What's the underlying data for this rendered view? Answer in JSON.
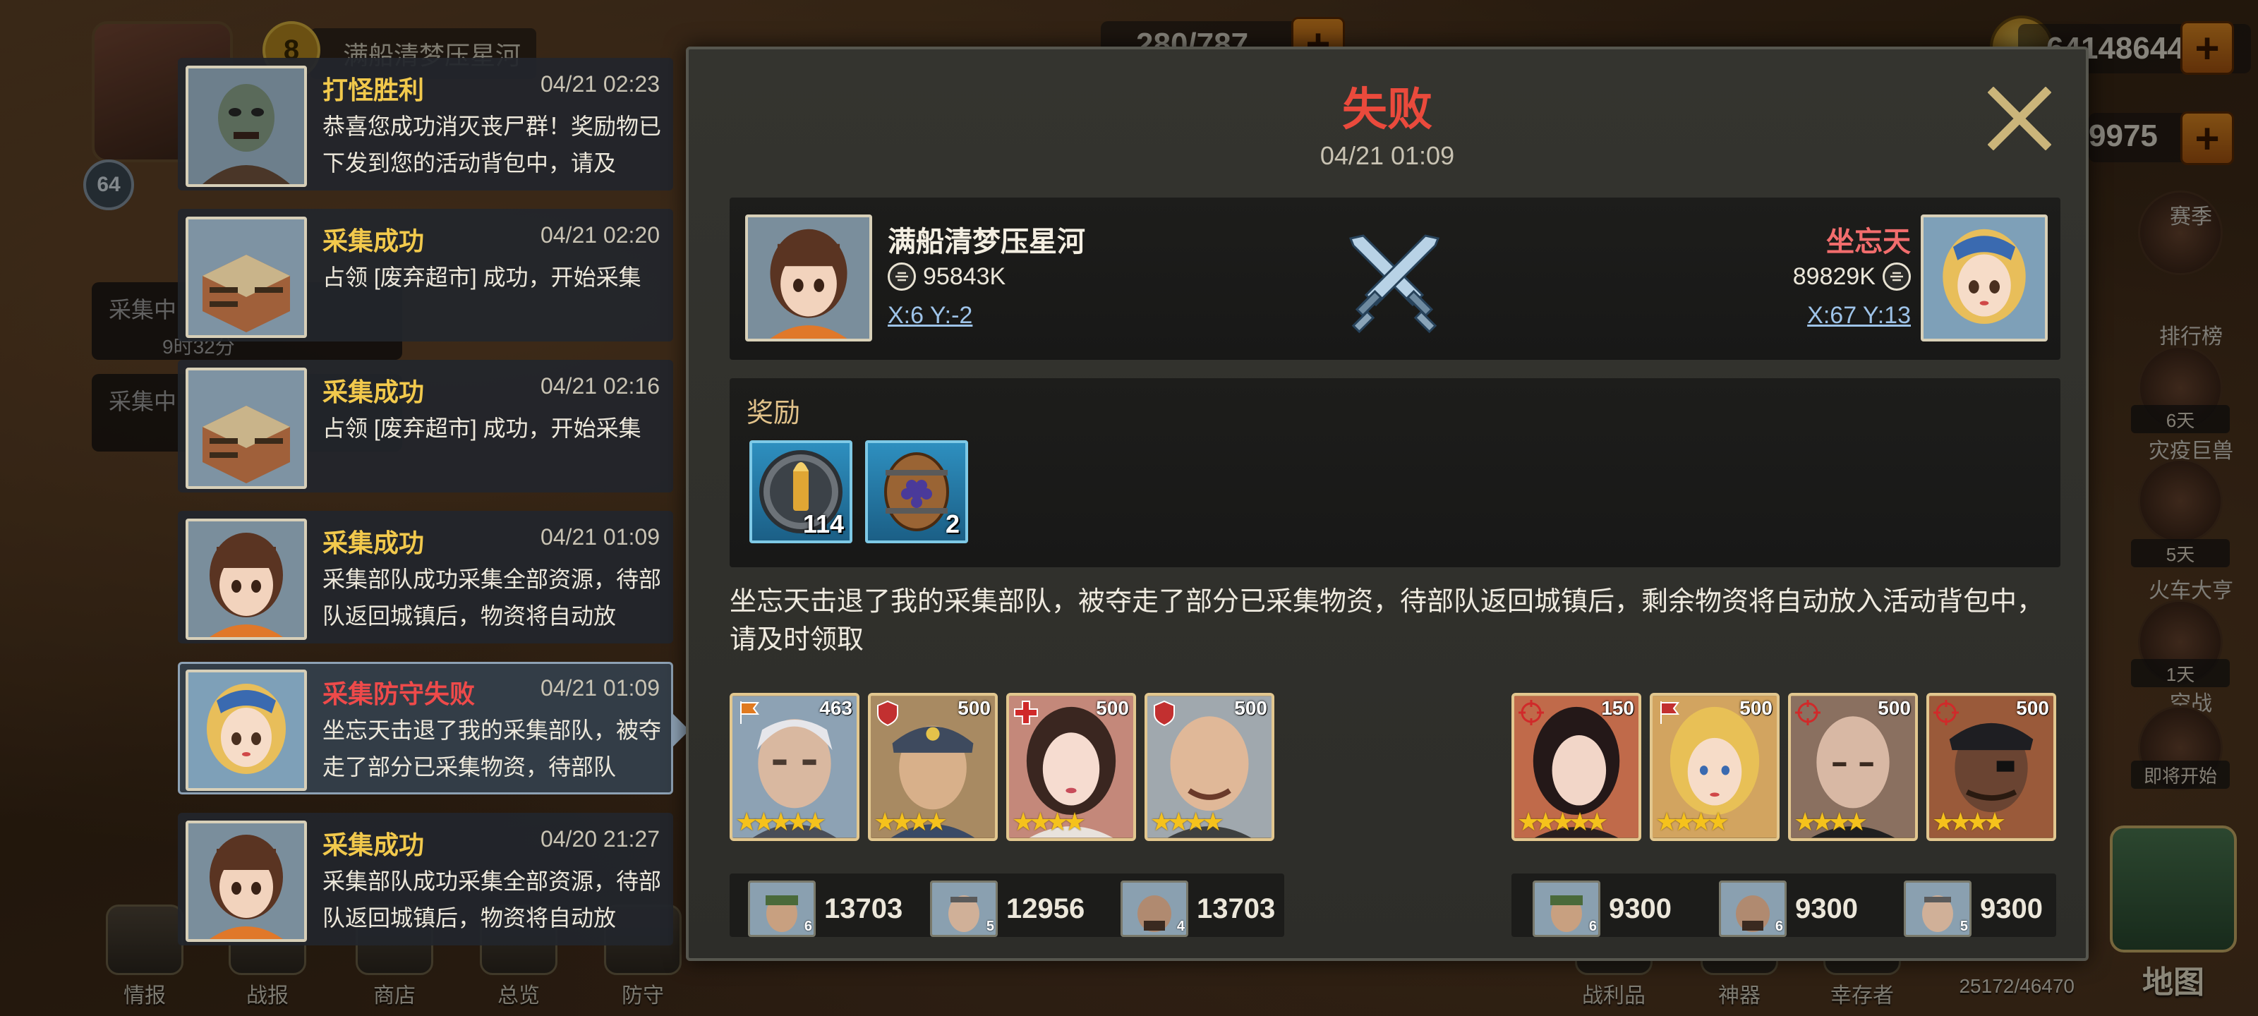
{
  "top_bar": {
    "level": "64",
    "vip": "8",
    "player_name": "满船清梦压星河",
    "troops": "280/787",
    "gold": "64148644",
    "second_resource": "9975"
  },
  "side_events": {
    "season": "赛季",
    "rank": "排行榜",
    "plague_days": "6天",
    "plague": "灾疫巨兽",
    "train_days": "5天",
    "train": "火车大亨",
    "air_days": "1天",
    "air": "空战",
    "coming": "即将开始"
  },
  "gather_status": {
    "item1": "采集中",
    "item1_timer": "9时32分",
    "item2": "采集中"
  },
  "mails": [
    {
      "title": "打怪胜利",
      "time": "04/21 02:23",
      "body": "恭喜您成功消灭丧尸群！奖励物已下发到您的活动背包中，请及",
      "status": "win"
    },
    {
      "title": "采集成功",
      "time": "04/21 02:20",
      "body": "占领 [废弃超市] 成功，开始采集",
      "status": "ok"
    },
    {
      "title": "采集成功",
      "time": "04/21 02:16",
      "body": "占领 [废弃超市] 成功，开始采集",
      "status": "ok"
    },
    {
      "title": "采集成功",
      "time": "04/21 01:09",
      "body": "采集部队成功采集全部资源，待部队返回城镇后，物资将自动放",
      "status": "ok"
    },
    {
      "title": "采集防守失败",
      "time": "04/21 01:09",
      "body": "坐忘天击退了我的采集部队，被夺走了部分已采集物资，待部队",
      "status": "fail"
    },
    {
      "title": "采集成功",
      "time": "04/20 21:27",
      "body": "采集部队成功采集全部资源，待部队返回城镇后，物资将自动放",
      "status": "ok"
    }
  ],
  "report": {
    "result": "失败",
    "date": "04/21 01:09",
    "self": {
      "name": "满船清梦压星河",
      "power": "95843K",
      "coord": "X:6 Y:-2"
    },
    "enemy": {
      "name": "坐忘天",
      "power": "89829K",
      "coord": "X:67 Y:13"
    },
    "reward_label": "奖励",
    "rewards": [
      {
        "icon": "bullet-shield-icon",
        "count": "114"
      },
      {
        "icon": "grape-barrel-icon",
        "count": "2"
      }
    ],
    "description": "坐忘天击退了我的采集部队，被夺走了部分已采集物资，待部队返回城镇后，剩余物资将自动放入活动背包中，请及时领取",
    "self_heroes": [
      {
        "level": "463",
        "stars": "★★★★★",
        "type": "flag"
      },
      {
        "level": "500",
        "stars": "★★★★",
        "type": "shield"
      },
      {
        "level": "500",
        "stars": "★★★★",
        "type": "medic"
      },
      {
        "level": "500",
        "stars": "★★★★",
        "type": "shield"
      }
    ],
    "enemy_heroes": [
      {
        "level": "150",
        "stars": "★★★★★",
        "type": "target"
      },
      {
        "level": "500",
        "stars": "★★★★",
        "type": "flag"
      },
      {
        "level": "500",
        "stars": "★★★★",
        "type": "target"
      },
      {
        "level": "500",
        "stars": "★★★★",
        "type": "target"
      }
    ],
    "self_troops": [
      {
        "count": "13703",
        "rank": "6"
      },
      {
        "count": "12956",
        "rank": "5"
      },
      {
        "count": "13703",
        "rank": "4"
      }
    ],
    "enemy_troops": [
      {
        "count": "9300",
        "rank": "6"
      },
      {
        "count": "9300",
        "rank": "6"
      },
      {
        "count": "9300",
        "rank": "5"
      }
    ]
  },
  "bottom_nav": {
    "intel": "情报",
    "battle": "战报",
    "shop": "商店",
    "overview": "总览",
    "defense": "防守",
    "spoils": "战利品",
    "artifact": "神器",
    "survivors": "幸存者",
    "survivor_count": "25172/46470",
    "map": "地图"
  },
  "colors": {
    "fail_red": "#ea4a3c",
    "gold_title": "#f2c94c",
    "coord_blue": "#9ec3e8",
    "enemy_name": "#f26d6d",
    "panel_bg": "#32322d"
  }
}
